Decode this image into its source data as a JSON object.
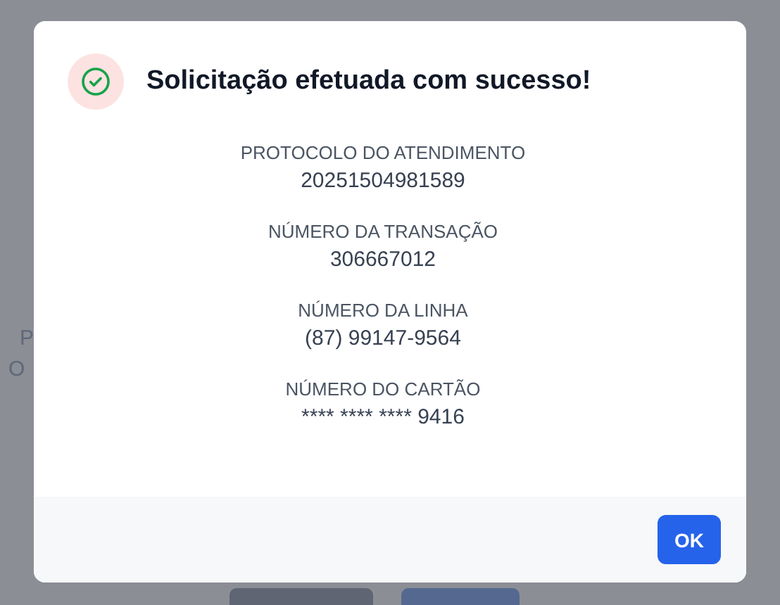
{
  "background": {
    "texts": [
      "P",
      "O"
    ]
  },
  "dialog": {
    "title": "Solicitação efetuada com sucesso!",
    "fields": [
      {
        "label": "PROTOCOLO DO ATENDIMENTO",
        "value": "20251504981589"
      },
      {
        "label": "NÚMERO DA TRANSAÇÃO",
        "value": "306667012"
      },
      {
        "label": "NÚMERO DA LINHA",
        "value": "(87) 99147-9564"
      },
      {
        "label": "NÚMERO DO CARTÃO",
        "value": "**** **** **** 9416"
      }
    ],
    "button": "OK"
  }
}
